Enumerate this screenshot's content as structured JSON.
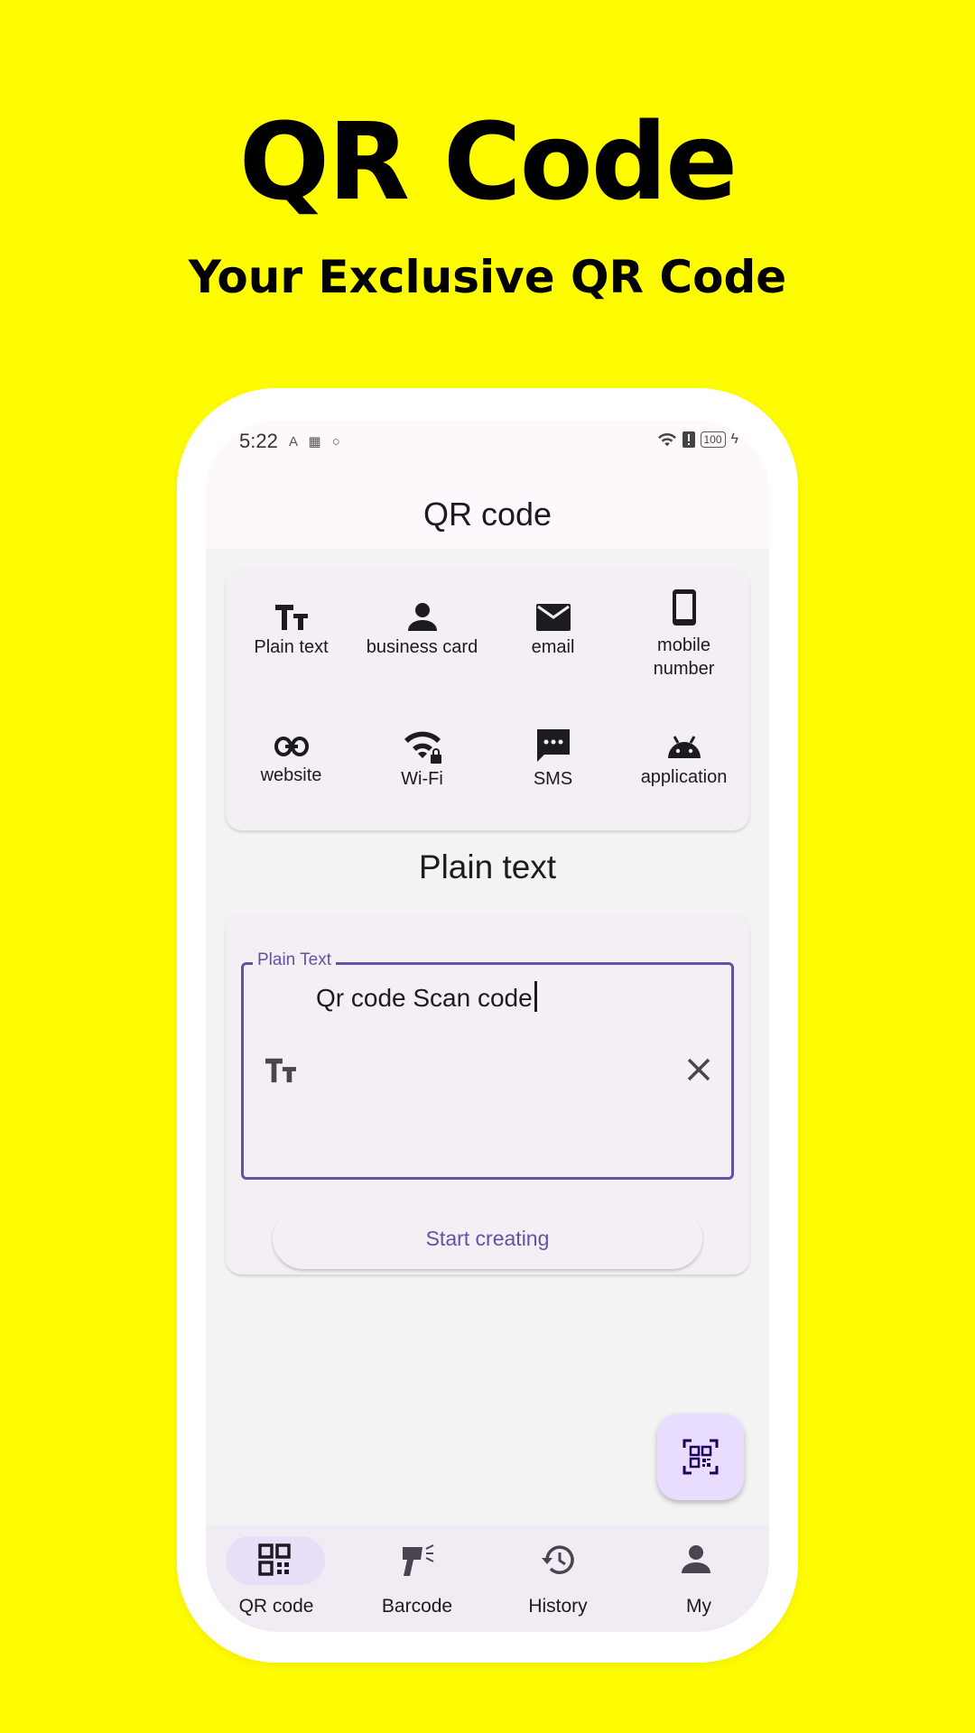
{
  "promo": {
    "title": "QR Code",
    "subtitle": "Your Exclusive QR Code"
  },
  "status_bar": {
    "time": "5:22",
    "battery": "100"
  },
  "app_bar": {
    "title": "QR code"
  },
  "types": [
    {
      "label": "Plain text",
      "icon": "text-fields-icon"
    },
    {
      "label": "business card",
      "icon": "person-icon"
    },
    {
      "label": "email",
      "icon": "email-icon"
    },
    {
      "label_line1": "mobile",
      "label_line2": "number",
      "icon": "phone-icon"
    },
    {
      "label": "website",
      "icon": "link-icon"
    },
    {
      "label": "Wi-Fi",
      "icon": "wifi-lock-icon"
    },
    {
      "label": "SMS",
      "icon": "sms-icon"
    },
    {
      "label": "application",
      "icon": "android-icon"
    }
  ],
  "section_title": "Plain text",
  "form": {
    "field_label": "Plain Text",
    "field_value": "Qr code Scan code",
    "submit_label": "Start creating"
  },
  "nav": [
    {
      "label": "QR code",
      "icon": "qr-code-icon",
      "selected": true
    },
    {
      "label": "Barcode",
      "icon": "barcode-scanner-icon"
    },
    {
      "label": "History",
      "icon": "history-icon"
    },
    {
      "label": "My",
      "icon": "person-icon"
    }
  ],
  "colors": {
    "background": "#fffb00",
    "accent": "#6750a4",
    "fab": "#e9ddff",
    "nav_indicator": "#e8def8"
  }
}
